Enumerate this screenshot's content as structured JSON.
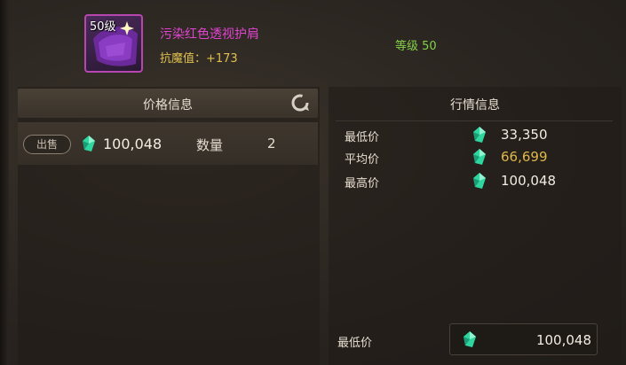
{
  "item": {
    "level_badge": "50级",
    "name": "污染红色透视护肩",
    "attribute": "抗魔值：+173",
    "level_text": "等级 50"
  },
  "price_panel": {
    "title": "价格信息",
    "sell_button": "出售",
    "price": "100,048",
    "quantity_label": "数量",
    "quantity": "2"
  },
  "market_panel": {
    "title": "行情信息",
    "stats": [
      {
        "label": "最低价",
        "value": "33,350"
      },
      {
        "label": "平均价",
        "value": "66,699"
      },
      {
        "label": "最高价",
        "value": "100,048"
      }
    ],
    "bottom_label": "最低价",
    "bottom_value": "100,048"
  },
  "colors": {
    "item_name": "#e044d0",
    "attribute": "#e0c050",
    "level": "#84d04a",
    "average": "#e0b84a",
    "gem": "#2fd6a0"
  },
  "icons": {
    "currency": "green-gem-icon",
    "refresh": "refresh-icon",
    "item": "purple-shoulder-armor-icon"
  }
}
